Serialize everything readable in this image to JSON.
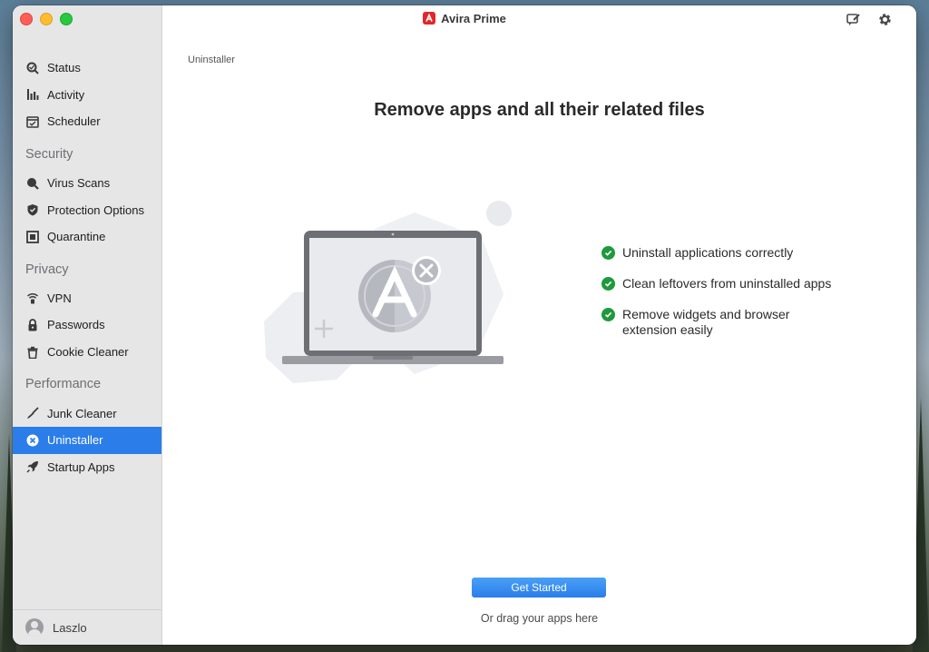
{
  "app": {
    "title": "Avira Prime"
  },
  "sidebar": {
    "items": [
      {
        "label": "Status",
        "icon": "status-icon"
      },
      {
        "label": "Activity",
        "icon": "activity-icon"
      },
      {
        "label": "Scheduler",
        "icon": "scheduler-icon"
      }
    ],
    "sections": [
      {
        "title": "Security",
        "items": [
          {
            "label": "Virus Scans",
            "icon": "scan-icon"
          },
          {
            "label": "Protection Options",
            "icon": "shield-icon"
          },
          {
            "label": "Quarantine",
            "icon": "quarantine-icon"
          }
        ]
      },
      {
        "title": "Privacy",
        "items": [
          {
            "label": "VPN",
            "icon": "vpn-icon"
          },
          {
            "label": "Passwords",
            "icon": "lock-icon"
          },
          {
            "label": "Cookie Cleaner",
            "icon": "trash-icon"
          }
        ]
      },
      {
        "title": "Performance",
        "items": [
          {
            "label": "Junk Cleaner",
            "icon": "broom-icon"
          },
          {
            "label": "Uninstaller",
            "icon": "uninstall-icon",
            "active": true
          },
          {
            "label": "Startup Apps",
            "icon": "rocket-icon"
          }
        ]
      }
    ],
    "user": {
      "name": "Laszlo"
    }
  },
  "main": {
    "breadcrumb": "Uninstaller",
    "headline": "Remove apps and all their related files",
    "features": [
      "Uninstall applications correctly",
      "Clean leftovers from uninstalled apps",
      "Remove widgets and browser extension easily"
    ],
    "cta": "Get Started",
    "drag_hint": "Or drag your apps here"
  },
  "colors": {
    "accent": "#2b7de9",
    "check": "#1e9a3c",
    "brand": "#e3262b"
  }
}
